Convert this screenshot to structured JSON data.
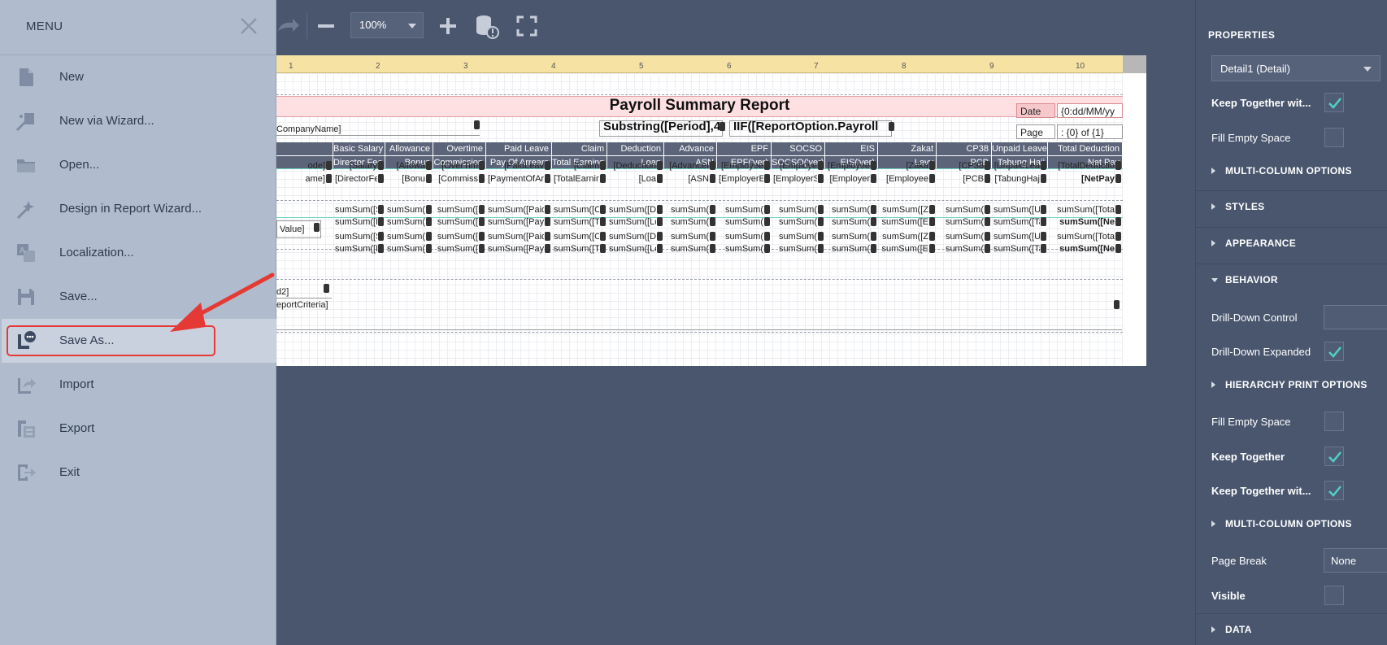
{
  "toolbar": {
    "zoom_value": "100%"
  },
  "report": {
    "title": "Payroll Summary Report",
    "ruler_ticks": [
      "1",
      "2",
      "3",
      "4",
      "5",
      "6",
      "7",
      "8",
      "9",
      "10"
    ],
    "company_field": "CompanyName]",
    "period_field": "Substring([Period],4",
    "payroll_field": "IIF([ReportOption.Payroll",
    "date_label": "Date",
    "date_value": "{0:dd/MM/yy",
    "page_label": "Page",
    "page_value": ": {0} of {1}",
    "header_row1": [
      "Basic Salary",
      "Allowance",
      "Overtime",
      "Paid Leave",
      "Claim",
      "Deduction",
      "Advance",
      "EPF",
      "SOCSO",
      "EIS",
      "Zakat",
      "CP38",
      "Unpaid Leave",
      "Total Deduction"
    ],
    "header_row2": [
      "Director Fee",
      "Bonus",
      "Commission",
      "Pay Of Arrears",
      "Total Earning",
      "Loan",
      "ASN",
      "EPF('yer)",
      "SOCSO('yer)",
      "EIS('yer)",
      "Levy",
      "PCB",
      "Tabung Haji",
      "Net Pay"
    ],
    "detail_row1": [
      "ode]",
      "[Salary",
      "[Allowa",
      "[OverTim",
      "[PaidLeav",
      "[Claim",
      "[Deduction",
      "[AdvanceI",
      "[Employee",
      "[Employe",
      "[Employee",
      "[Zaka",
      "[CP38",
      "[UnpaidLea",
      "[TotalDeductio"
    ],
    "detail_row2": [
      "ame]",
      "[DirectorFe",
      "[Bonu",
      "[Commiss",
      "[PaymentOfAr",
      "[TotalEarning",
      "[Loa",
      "[ASN",
      "[EmployerE",
      "[EmployerS",
      "[Employer",
      "[Employee",
      "[PCB",
      "[TabungHaj",
      "[NetPay"
    ],
    "group_value_field": "Value]",
    "sum_row1": [
      "sumSum([S",
      "sumSum(",
      "sumSum([",
      "sumSum([Paid",
      "sumSum([Cl",
      "sumSum([De",
      "sumSum(",
      "sumSum(",
      "sumSum(",
      "sumSum(",
      "sumSum([Z",
      "sumSum(",
      "sumSum([U",
      "sumSum([Tota"
    ],
    "sum_row2": [
      "sumSum([D",
      "sumSum(",
      "sumSum([",
      "sumSum([Pay",
      "sumSum([Tot",
      "sumSum([Lo",
      "sumSum(",
      "sumSum(",
      "sumSum(",
      "sumSum(",
      "sumSum([E",
      "sumSum(",
      "sumSum([Ta",
      "sumSum([Ne"
    ],
    "footer_field1": "d2]",
    "footer_field2": "eportCriteria]"
  },
  "menu": {
    "title": "MENU",
    "items": [
      {
        "label": "New",
        "icon": "new-file-icon"
      },
      {
        "label": "New via Wizard...",
        "icon": "wizard-icon"
      },
      {
        "label": "Open...",
        "icon": "folder-icon"
      },
      {
        "label": "Design in Report Wizard...",
        "icon": "design-wizard-icon"
      },
      {
        "label": "Localization...",
        "icon": "localization-icon"
      },
      {
        "label": "Save...",
        "icon": "save-icon"
      },
      {
        "label": "Save As...",
        "icon": "save-as-icon"
      },
      {
        "label": "Import",
        "icon": "import-icon"
      },
      {
        "label": "Export",
        "icon": "export-icon"
      },
      {
        "label": "Exit",
        "icon": "exit-icon"
      }
    ],
    "active_item": "Save As...",
    "annotation_color": "#e53935"
  },
  "properties": {
    "title": "PROPERTIES",
    "selected_component": "Detail1 (Detail)",
    "keep_together_with_1": "Keep Together wit...",
    "fill_empty_space_1": "Fill Empty Space",
    "multi_column_1": "MULTI-COLUMN OPTIONS",
    "styles": "STYLES",
    "appearance": "APPEARANCE",
    "behavior": "BEHAVIOR",
    "drill_down_control": "Drill-Down Control",
    "drill_down_expanded": "Drill-Down Expanded",
    "hierarchy_print": "HIERARCHY PRINT OPTIONS",
    "fill_empty_space_2": "Fill Empty Space",
    "keep_together": "Keep Together",
    "keep_together_with_2": "Keep Together wit...",
    "multi_column_2": "MULTI-COLUMN OPTIONS",
    "page_break": "Page Break",
    "page_break_value": "None",
    "visible": "Visible",
    "data": "DATA",
    "check_color": "#4fd1c5"
  }
}
